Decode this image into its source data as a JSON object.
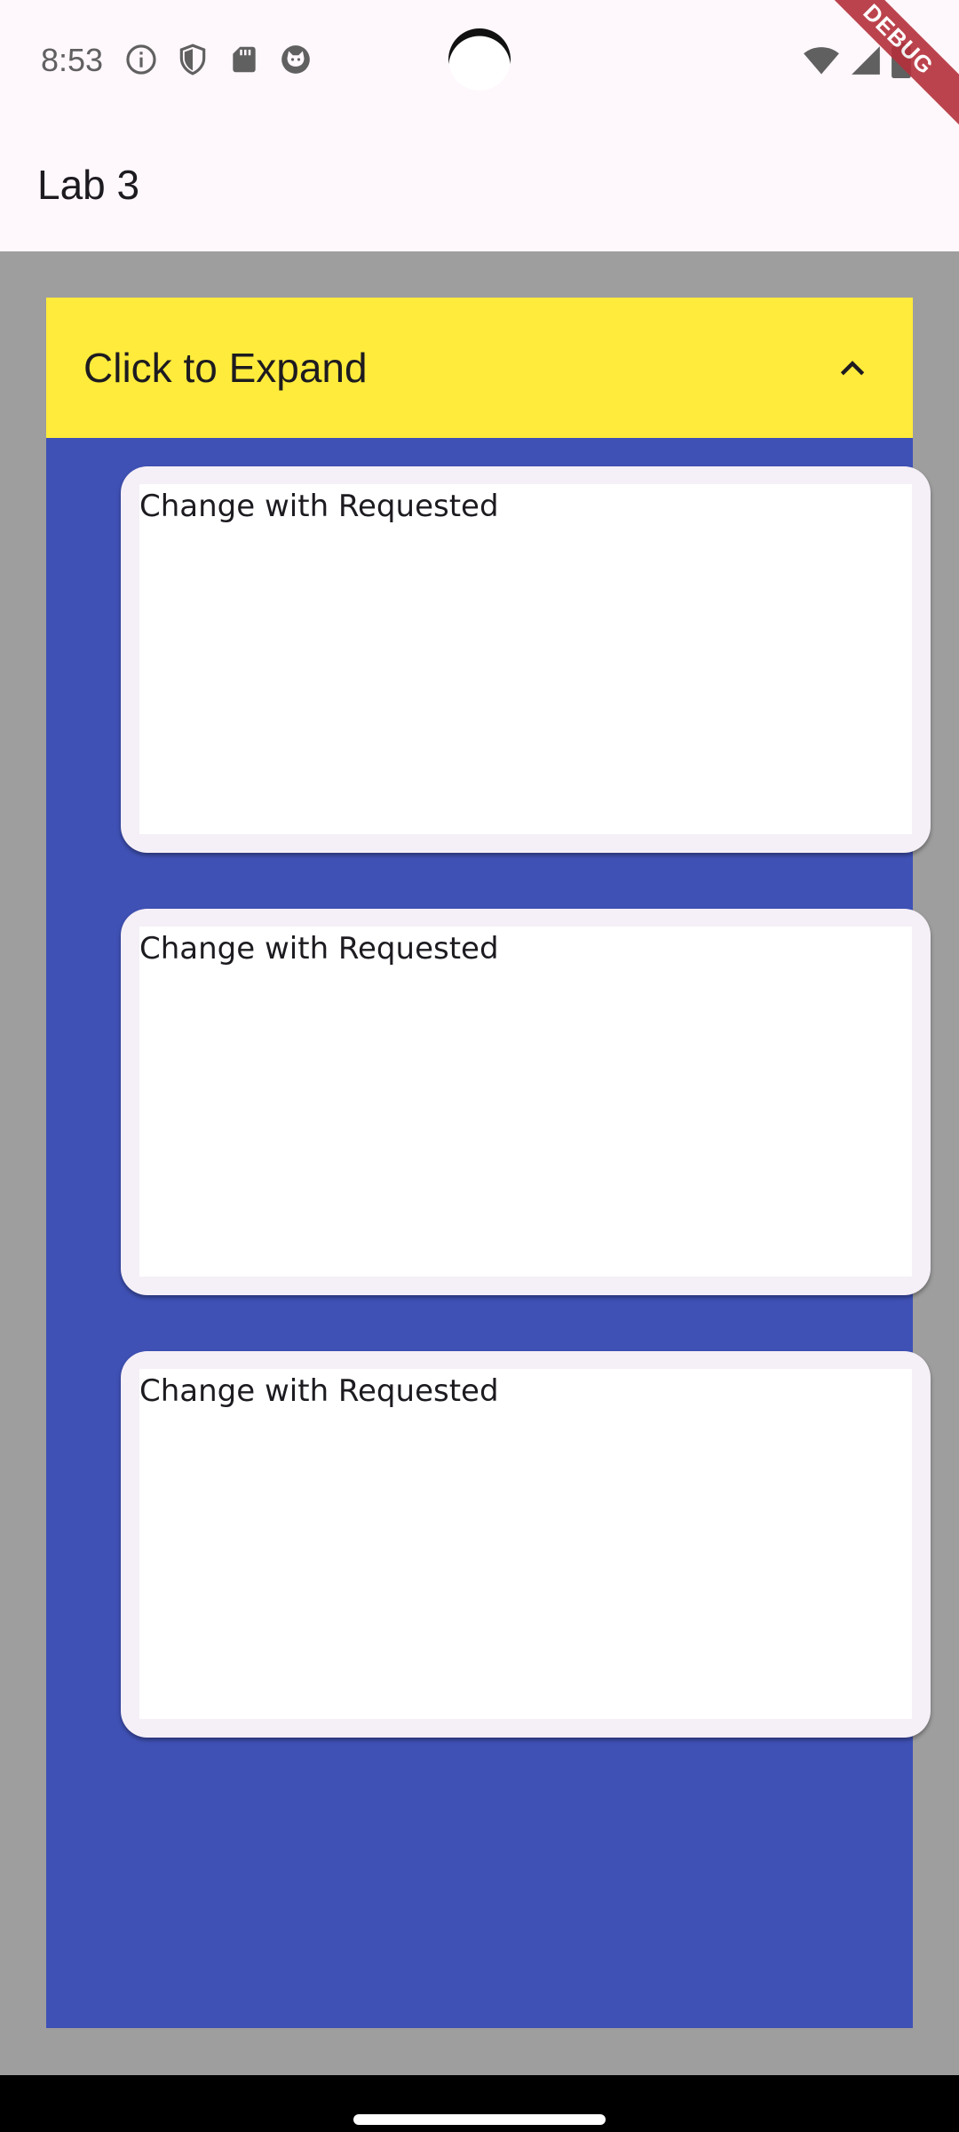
{
  "status_bar": {
    "time": "8:53",
    "left_icons": [
      "info-icon",
      "shield-icon",
      "sd-card-icon",
      "cat-face-icon"
    ],
    "right_icons": [
      "wifi-icon",
      "signal-icon",
      "battery-icon"
    ],
    "debug_label": "DEBUG"
  },
  "app_bar": {
    "title": "Lab 3"
  },
  "expansion_panel": {
    "header": "Click to Expand",
    "expanded": true,
    "header_color": "#ffeb3b",
    "body_color": "#3f51b5",
    "toggle_icon": "chevron-up-icon"
  },
  "cards": [
    {
      "text": "Change with Requested"
    },
    {
      "text": "Change with Requested"
    },
    {
      "text": "Change with Requested"
    }
  ],
  "colors": {
    "background": "#9e9e9e",
    "app_bar": "#fef7fc",
    "card_surface": "#f5eff7",
    "debug_banner": "#b4303b"
  }
}
